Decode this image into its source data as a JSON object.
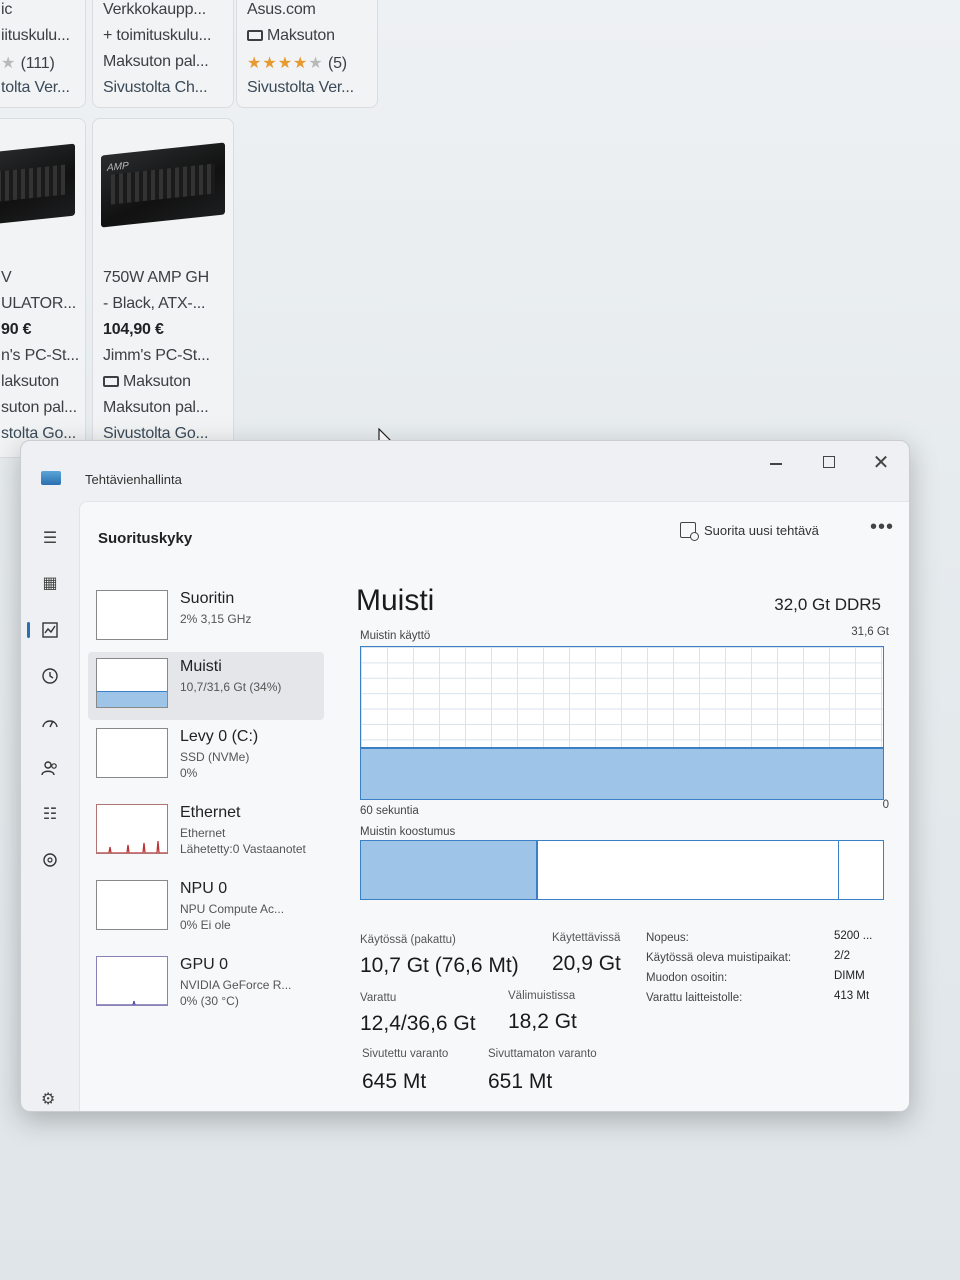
{
  "shop": {
    "cards_top": [
      {
        "lines": [
          "ic",
          "iituskulu...",
          "(111)",
          "tolta Ver..."
        ]
      },
      {
        "lines": [
          "Verkkokaupp...",
          "+ toimituskulu...",
          "Maksuton pal...",
          "Sivustolta Ch..."
        ]
      },
      {
        "lines": [
          "Asus.com",
          "Maksuton",
          "(5)",
          "Sivustolta Ver..."
        ]
      }
    ],
    "cards_bottom": [
      {
        "lines": [
          "V",
          "ULATOR...",
          "90 €",
          "n's PC-St...",
          "laksuton",
          "suton pal...",
          "stolta Go..."
        ]
      },
      {
        "lines": [
          "750W AMP GH",
          "- Black, ATX-...",
          "104,90 €",
          "Jimm's PC-St...",
          "Maksuton",
          "Maksuton pal...",
          "Sivustolta Go..."
        ]
      }
    ],
    "psu_brand": "AMP"
  },
  "window": {
    "title": "Tehtävienhallinta",
    "page_title": "Suorituskyky",
    "run_task": "Suorita uusi tehtävä",
    "more": "•••"
  },
  "devices": [
    {
      "name": "Suoritin",
      "sub1": "2% 3,15 GHz",
      "sub2": ""
    },
    {
      "name": "Muisti",
      "sub1": "10,7/31,6 Gt (34%)",
      "sub2": "",
      "fill": 0.34
    },
    {
      "name": "Levy 0 (C:)",
      "sub1": "SSD (NVMe)",
      "sub2": "0%"
    },
    {
      "name": "Ethernet",
      "sub1": "Ethernet",
      "sub2": "Lähetetty:0 Vastaanotet"
    },
    {
      "name": "NPU 0",
      "sub1": "NPU Compute Ac...",
      "sub2": "0% Ei ole"
    },
    {
      "name": "GPU 0",
      "sub1": "NVIDIA GeForce R...",
      "sub2": "0% (30 °C)"
    }
  ],
  "memory": {
    "title": "Muisti",
    "spec": "32,0 Gt DDR5",
    "usage_label": "Muistin käyttö",
    "max_label": "31,6 Gt",
    "time_label": "60 sekuntia",
    "zero_label": "0",
    "usage_fraction": 0.34,
    "composition_label": "Muistin koostumus",
    "composition": {
      "in_use": 0.34,
      "standby_end": 0.915
    },
    "in_use_label": "Käytössä (pakattu)",
    "in_use_value": "10,7 Gt (76,6 Mt)",
    "available_label": "Käytettävissä",
    "available_value": "20,9 Gt",
    "committed_label": "Varattu",
    "committed_value": "12,4/36,6 Gt",
    "cached_label": "Välimuistissa",
    "cached_value": "18,2 Gt",
    "paged_label": "Sivutettu varanto",
    "paged_value": "645 Mt",
    "nonpaged_label": "Sivuttamaton varanto",
    "nonpaged_value": "651 Mt",
    "props": [
      {
        "k": "Nopeus:",
        "v": "5200 ..."
      },
      {
        "k": "Käytössä oleva muistipaikat:",
        "v": "2/2"
      },
      {
        "k": "Muodon osoitin:",
        "v": "DIMM"
      },
      {
        "k": "Varattu laitteistolle:",
        "v": "413 Mt"
      }
    ]
  },
  "colors": {
    "accent": "#3b7fc4",
    "fill": "#9ec5e8"
  }
}
